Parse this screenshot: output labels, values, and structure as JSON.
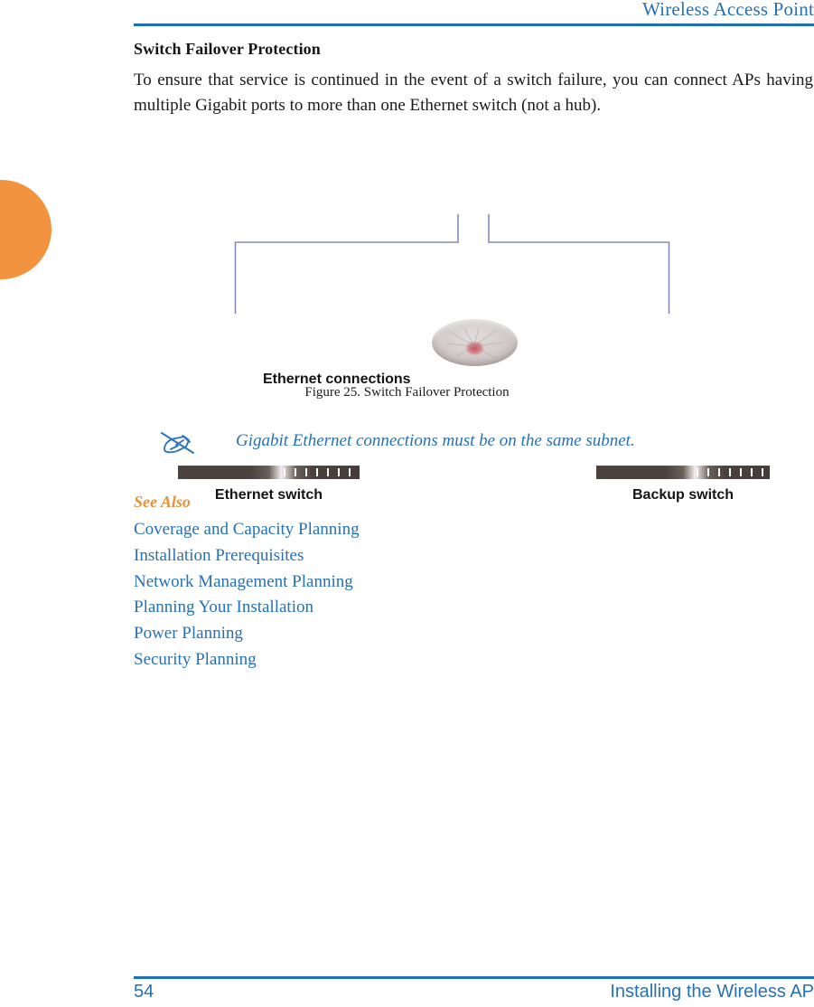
{
  "header": {
    "title": "Wireless Access Point",
    "rule_color": "#1F6FB5"
  },
  "content": {
    "heading": "Switch Failover Protection",
    "paragraph": "To ensure that service is continued in the event of a switch failure, you can connect APs having multiple Gigabit ports to more than one Ethernet switch (not a hub)."
  },
  "figure": {
    "connections_label": "Ethernet connections",
    "left_switch_label": "Ethernet switch",
    "right_switch_label": "Backup switch",
    "ap_device_name": "access-point-device",
    "caption": "Figure 25. Switch Failover Protection",
    "line_color": "#8789BE",
    "switch_body_color": "#4B423E",
    "port_count": 7
  },
  "note": {
    "icon": "writing-hand-icon",
    "text": "Gigabit Ethernet connections must be on the same subnet.",
    "color": "#2670B8"
  },
  "see_also": {
    "title": "See Also",
    "title_color": "#E8913A",
    "links": [
      "Coverage and Capacity Planning",
      "Installation Prerequisites",
      "Network Management Planning",
      "Planning Your Installation",
      "Power Planning",
      "Security Planning"
    ]
  },
  "footer": {
    "page_number": "54",
    "title": "Installing the Wireless AP"
  },
  "decor": {
    "edge_tab_color": "#F2943F"
  }
}
